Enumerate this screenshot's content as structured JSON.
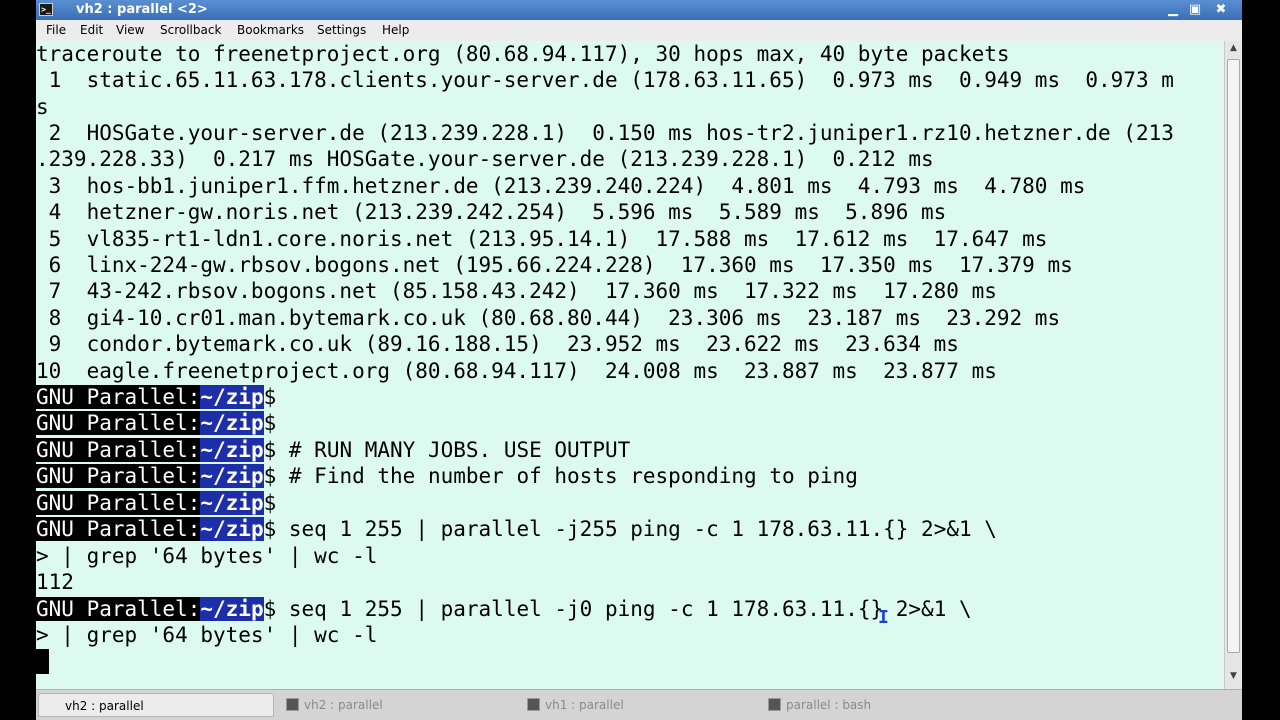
{
  "window": {
    "title": "vh2 : parallel <2>",
    "system_icon": "terminal-icon",
    "controls": {
      "minimize": "minimize-icon",
      "maximize": "maximize-icon",
      "close": "close-icon"
    }
  },
  "menu": [
    "File",
    "Edit",
    "View",
    "Scrollback",
    "Bookmarks",
    "Settings",
    "Help"
  ],
  "terminal": {
    "lines": [
      "traceroute to freenetproject.org (80.68.94.117), 30 hops max, 40 byte packets",
      " 1  static.65.11.63.178.clients.your-server.de (178.63.11.65)  0.973 ms  0.949 ms  0.973 m",
      "s",
      " 2  HOSGate.your-server.de (213.239.228.1)  0.150 ms hos-tr2.juniper1.rz10.hetzner.de (213",
      ".239.228.33)  0.217 ms HOSGate.your-server.de (213.239.228.1)  0.212 ms",
      " 3  hos-bb1.juniper1.ffm.hetzner.de (213.239.240.224)  4.801 ms  4.793 ms  4.780 ms",
      " 4  hetzner-gw.noris.net (213.239.242.254)  5.596 ms  5.589 ms  5.896 ms",
      " 5  vl835-rt1-ldn1.core.noris.net (213.95.14.1)  17.588 ms  17.612 ms  17.647 ms",
      " 6  linx-224-gw.rbsov.bogons.net (195.66.224.228)  17.360 ms  17.350 ms  17.379 ms",
      " 7  43-242.rbsov.bogons.net (85.158.43.242)  17.360 ms  17.322 ms  17.280 ms",
      " 8  gi4-10.cr01.man.bytemark.co.uk (80.68.80.44)  23.306 ms  23.187 ms  23.292 ms",
      " 9  condor.bytemark.co.uk (89.16.188.15)  23.952 ms  23.622 ms  23.634 ms",
      "10  eagle.freenetproject.org (80.68.94.117)  24.008 ms  23.887 ms  23.877 ms"
    ],
    "prompt": {
      "host": "GNU Parallel:",
      "dir": "~/zip",
      "sign": "$"
    },
    "commands": [
      "",
      "",
      " # RUN MANY JOBS. USE OUTPUT",
      " # Find the number of hosts responding to ping",
      "",
      " seq 1 255 | parallel -j255 ping -c 1 178.63.11.{} 2>&1 \\",
      null,
      null,
      " seq 1 255 | parallel -j0 ping -c 1 178.63.11.{} 2>&1 \\",
      null
    ],
    "continuations": {
      "c1": "> | grep '64 bytes' | wc -l",
      "out1": "112",
      "c2": "> | grep '64 bytes' | wc -l"
    },
    "text_cursor": "I"
  },
  "tabs": [
    {
      "label": "vh2 : parallel",
      "active": true
    },
    {
      "label": "vh2 : parallel",
      "active": false
    },
    {
      "label": "vh1 : parallel",
      "active": false
    },
    {
      "label": "parallel : bash",
      "active": false
    }
  ]
}
